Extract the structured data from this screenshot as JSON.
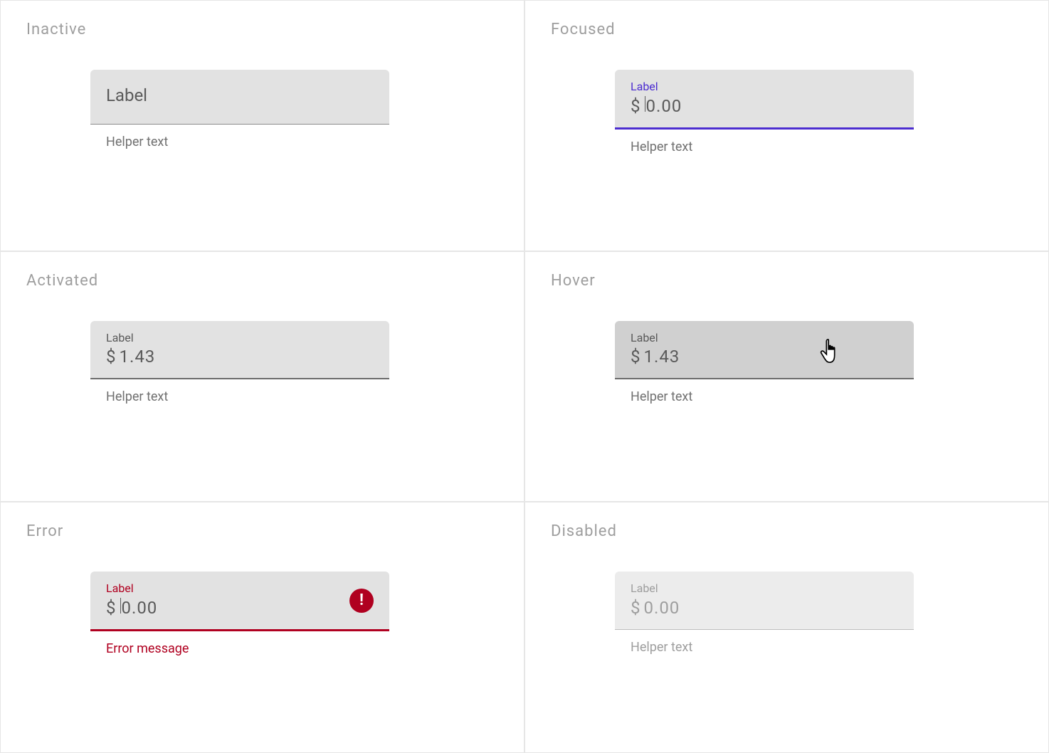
{
  "colors": {
    "focus": "#4c2dd0",
    "error": "#b00020",
    "field_bg": "#e2e2e2",
    "hover_bg": "#d0d0d0",
    "disabled_bg": "#ececec",
    "text_muted": "#9e9e9e"
  },
  "states": {
    "inactive": {
      "title": "Inactive",
      "label": "Label",
      "helper": "Helper text"
    },
    "focused": {
      "title": "Focused",
      "label": "Label",
      "prefix": "$",
      "value": "0.00",
      "helper": "Helper text"
    },
    "activated": {
      "title": "Activated",
      "label": "Label",
      "prefix": "$",
      "value": "1.43",
      "helper": "Helper text"
    },
    "hover": {
      "title": "Hover",
      "label": "Label",
      "prefix": "$",
      "value": "1.43",
      "helper": "Helper text"
    },
    "error": {
      "title": "Error",
      "label": "Label",
      "prefix": "$",
      "value": "0.00",
      "helper": "Error message"
    },
    "disabled": {
      "title": "Disabled",
      "label": "Label",
      "prefix": "$",
      "value": "0.00",
      "helper": "Helper text"
    }
  }
}
